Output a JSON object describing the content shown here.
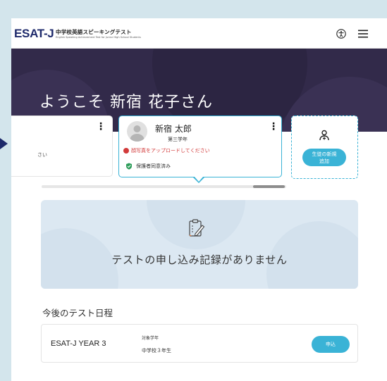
{
  "header": {
    "logo": "ESAT-J",
    "logo_jp": "中学校英語スピーキングテスト",
    "logo_en": "English Speaking Achievement Test for Junior High School Students"
  },
  "hero": {
    "welcome": "ようこそ 新宿 花子さん"
  },
  "students": {
    "left_card_text": "さい",
    "main": {
      "name": "新宿 太郎",
      "grade": "第三学年",
      "warning": "顔写真をアップロードしてください",
      "consent": "保護者同意済み"
    },
    "add_label_line1": "生徒の新規",
    "add_label_line2": "追加"
  },
  "empty_state": {
    "message": "テストの申し込み記録がありません"
  },
  "schedule": {
    "title": "今後のテスト日程",
    "items": [
      {
        "name": "ESAT-J YEAR 3",
        "grade_label": "対象学年",
        "grade_value": "中学校３年生",
        "button": "申込"
      }
    ]
  },
  "colors": {
    "accent": "#3ab3d6",
    "hero_bg": "#322a4a",
    "brand": "#1e2a6b",
    "warning": "#d23a3a",
    "ok": "#2e9d5a"
  },
  "icons": [
    "accessibility-icon",
    "hamburger-menu-icon",
    "more-vert-icon",
    "add-person-icon",
    "clipboard-edit-icon",
    "warning-dot-icon",
    "shield-check-icon"
  ]
}
